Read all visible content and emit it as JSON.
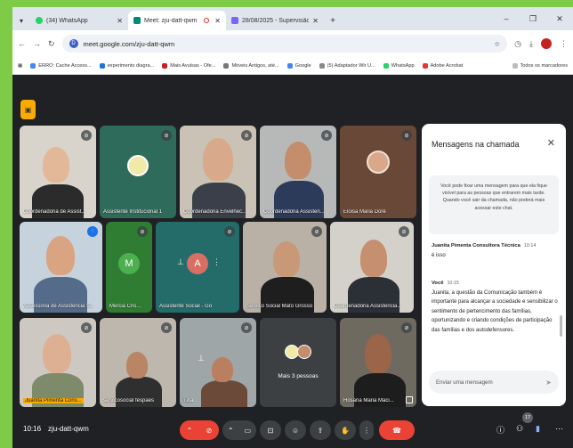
{
  "browser": {
    "tabs": [
      {
        "title": "(34) WhatsApp",
        "favicon_color": "#25d366"
      },
      {
        "title": "Meet: zju-datt-qwm",
        "favicon_color": "#00897b"
      },
      {
        "title": "28/08/2025 - Supervisão Técnica",
        "favicon_color": "#7b61ff"
      }
    ],
    "url": "meet.google.com/zju-datt-qwm",
    "site_badge": "D",
    "new_tab_label": "+",
    "bookmarks": [
      "ERRO: Cache Access...",
      "experimento diagra...",
      "Mais Avulsas - Ofe...",
      "Móveis Antigos, até...",
      "Google",
      "(5) Adaptador Wir U...",
      "WhatsApp",
      "Adobe Acrobat"
    ],
    "all_bookmarks_label": "Todos os marcadores"
  },
  "participants": [
    {
      "name": "Coordenadoria de Assist...",
      "mic": "muted"
    },
    {
      "name": "Assistente Institucional 1",
      "mic": "muted"
    },
    {
      "name": "Coordenadoria Envelhec...",
      "mic": "muted"
    },
    {
      "name": "Coordenadoria Assisten...",
      "mic": "muted"
    },
    {
      "name": "Eloisa Maria Doré",
      "mic": "muted"
    },
    {
      "name": "Assessoria de Assistencia S...",
      "mic": "active"
    },
    {
      "name": "Mercia Cris...",
      "mic": "muted",
      "initial": "M"
    },
    {
      "name": "Assistente Social - Go",
      "mic": "muted",
      "initial": "A"
    },
    {
      "name": "Serviço Social Mato Grosso",
      "mic": "muted"
    },
    {
      "name": "Coordenadoria Assistencia...",
      "mic": "muted"
    },
    {
      "name": "Juanita Pimenta Cons...",
      "mic": "muted"
    },
    {
      "name": "servicosocial fespaes",
      "mic": "muted"
    },
    {
      "name": "Tina",
      "mic": "muted"
    },
    {
      "name": "Mais 3 pessoas",
      "mic": "none"
    },
    {
      "name": "Hosana Maria Maci...",
      "mic": "muted"
    }
  ],
  "chat": {
    "title": "Mensagens na chamada",
    "notice": "Você pode fixar uma mensagem para que ela fique visível para as pessoas que entrarem mais tarde. Quando você sair da chamada, não poderá mais acessar este chat.",
    "messages": [
      {
        "sender": "Juanita Pimenta Consultora Técnica",
        "time": "10:14",
        "text": "é isso"
      },
      {
        "sender": "Você",
        "time": "10:15",
        "text": "Juanita, a questão da Comunicação também é importante para alcançar a sociedade e sensibilizar o sentimento de pertencimento das famílias, oportunizando e criando condições de participação das famílias e dos autodefensores."
      }
    ],
    "input_placeholder": "Enviar uma mensagem"
  },
  "meeting": {
    "time": "10:16",
    "code": "zju-datt-qwm",
    "participant_count": "17"
  },
  "colors": {
    "accent_red": "#ea4335",
    "panel_bg": "#202124",
    "control_bg": "#3c4043",
    "yellow": "#f9ab00"
  }
}
